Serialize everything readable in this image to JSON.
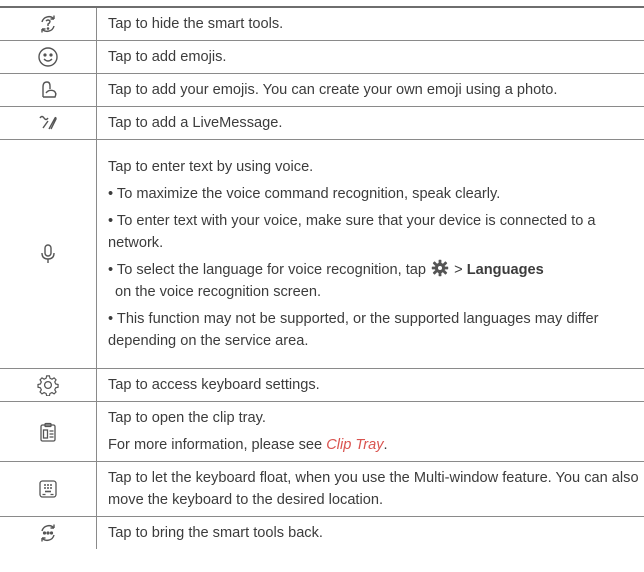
{
  "rows": {
    "hide_tools": {
      "icon": "hide-smart-tools-icon",
      "text": "Tap to hide the smart tools."
    },
    "emojis": {
      "icon": "smiley-emoji-icon",
      "text": "Tap to add emojis."
    },
    "your_emojis": {
      "icon": "custom-emoji-icon",
      "text": "Tap to add your emojis. You can create your own emoji using a photo."
    },
    "livemessage": {
      "icon": "livemessage-icon",
      "text": "Tap to add a LiveMessage."
    },
    "voice": {
      "icon": "microphone-icon",
      "intro": "Tap to enter text by using voice.",
      "bullet1": "• To maximize the voice command recognition, speak clearly.",
      "bullet2": "• To enter text with your voice, make sure that your device is connected to a network.",
      "bullet3_pre": "• To select the language for voice recognition, tap",
      "bullet3_gt": ">",
      "bullet3_bold": "Languages",
      "bullet3_post": "on the voice recognition screen.",
      "bullet4": "• This function may not be supported, or the supported languages may differ depending on the service area."
    },
    "settings": {
      "icon": "settings-gear-icon",
      "text": "Tap to access keyboard settings."
    },
    "clip_tray": {
      "icon": "clipboard-icon",
      "text": "Tap to open the clip tray.",
      "more_pre": "For more information, please see",
      "more_link": "Clip Tray",
      "more_post": "."
    },
    "float": {
      "icon": "floating-keyboard-icon",
      "text": "Tap to let the keyboard float, when you use the Multi-window feature. You can also move the keyboard to the desired location."
    },
    "bring_back": {
      "icon": "show-smart-tools-icon",
      "text": "Tap to bring the smart tools back."
    }
  },
  "colors": {
    "text": "#3c3c3c",
    "rule": "#8a8a8a",
    "link": "#d9534f",
    "icon": "#555555"
  }
}
